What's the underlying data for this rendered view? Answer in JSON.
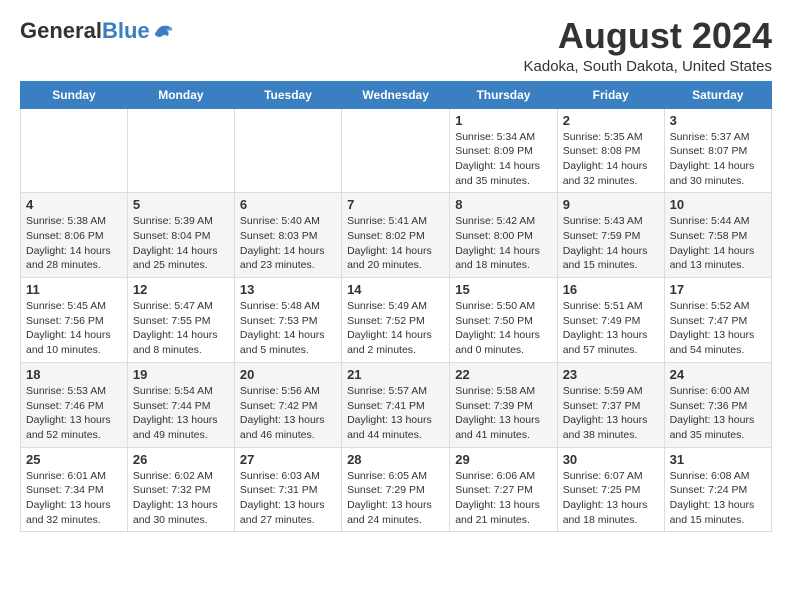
{
  "header": {
    "logo_general": "General",
    "logo_blue": "Blue",
    "month_title": "August 2024",
    "location": "Kadoka, South Dakota, United States"
  },
  "weekdays": [
    "Sunday",
    "Monday",
    "Tuesday",
    "Wednesday",
    "Thursday",
    "Friday",
    "Saturday"
  ],
  "weeks": [
    [
      {
        "day": "",
        "info": ""
      },
      {
        "day": "",
        "info": ""
      },
      {
        "day": "",
        "info": ""
      },
      {
        "day": "",
        "info": ""
      },
      {
        "day": "1",
        "info": "Sunrise: 5:34 AM\nSunset: 8:09 PM\nDaylight: 14 hours\nand 35 minutes."
      },
      {
        "day": "2",
        "info": "Sunrise: 5:35 AM\nSunset: 8:08 PM\nDaylight: 14 hours\nand 32 minutes."
      },
      {
        "day": "3",
        "info": "Sunrise: 5:37 AM\nSunset: 8:07 PM\nDaylight: 14 hours\nand 30 minutes."
      }
    ],
    [
      {
        "day": "4",
        "info": "Sunrise: 5:38 AM\nSunset: 8:06 PM\nDaylight: 14 hours\nand 28 minutes."
      },
      {
        "day": "5",
        "info": "Sunrise: 5:39 AM\nSunset: 8:04 PM\nDaylight: 14 hours\nand 25 minutes."
      },
      {
        "day": "6",
        "info": "Sunrise: 5:40 AM\nSunset: 8:03 PM\nDaylight: 14 hours\nand 23 minutes."
      },
      {
        "day": "7",
        "info": "Sunrise: 5:41 AM\nSunset: 8:02 PM\nDaylight: 14 hours\nand 20 minutes."
      },
      {
        "day": "8",
        "info": "Sunrise: 5:42 AM\nSunset: 8:00 PM\nDaylight: 14 hours\nand 18 minutes."
      },
      {
        "day": "9",
        "info": "Sunrise: 5:43 AM\nSunset: 7:59 PM\nDaylight: 14 hours\nand 15 minutes."
      },
      {
        "day": "10",
        "info": "Sunrise: 5:44 AM\nSunset: 7:58 PM\nDaylight: 14 hours\nand 13 minutes."
      }
    ],
    [
      {
        "day": "11",
        "info": "Sunrise: 5:45 AM\nSunset: 7:56 PM\nDaylight: 14 hours\nand 10 minutes."
      },
      {
        "day": "12",
        "info": "Sunrise: 5:47 AM\nSunset: 7:55 PM\nDaylight: 14 hours\nand 8 minutes."
      },
      {
        "day": "13",
        "info": "Sunrise: 5:48 AM\nSunset: 7:53 PM\nDaylight: 14 hours\nand 5 minutes."
      },
      {
        "day": "14",
        "info": "Sunrise: 5:49 AM\nSunset: 7:52 PM\nDaylight: 14 hours\nand 2 minutes."
      },
      {
        "day": "15",
        "info": "Sunrise: 5:50 AM\nSunset: 7:50 PM\nDaylight: 14 hours\nand 0 minutes."
      },
      {
        "day": "16",
        "info": "Sunrise: 5:51 AM\nSunset: 7:49 PM\nDaylight: 13 hours\nand 57 minutes."
      },
      {
        "day": "17",
        "info": "Sunrise: 5:52 AM\nSunset: 7:47 PM\nDaylight: 13 hours\nand 54 minutes."
      }
    ],
    [
      {
        "day": "18",
        "info": "Sunrise: 5:53 AM\nSunset: 7:46 PM\nDaylight: 13 hours\nand 52 minutes."
      },
      {
        "day": "19",
        "info": "Sunrise: 5:54 AM\nSunset: 7:44 PM\nDaylight: 13 hours\nand 49 minutes."
      },
      {
        "day": "20",
        "info": "Sunrise: 5:56 AM\nSunset: 7:42 PM\nDaylight: 13 hours\nand 46 minutes."
      },
      {
        "day": "21",
        "info": "Sunrise: 5:57 AM\nSunset: 7:41 PM\nDaylight: 13 hours\nand 44 minutes."
      },
      {
        "day": "22",
        "info": "Sunrise: 5:58 AM\nSunset: 7:39 PM\nDaylight: 13 hours\nand 41 minutes."
      },
      {
        "day": "23",
        "info": "Sunrise: 5:59 AM\nSunset: 7:37 PM\nDaylight: 13 hours\nand 38 minutes."
      },
      {
        "day": "24",
        "info": "Sunrise: 6:00 AM\nSunset: 7:36 PM\nDaylight: 13 hours\nand 35 minutes."
      }
    ],
    [
      {
        "day": "25",
        "info": "Sunrise: 6:01 AM\nSunset: 7:34 PM\nDaylight: 13 hours\nand 32 minutes."
      },
      {
        "day": "26",
        "info": "Sunrise: 6:02 AM\nSunset: 7:32 PM\nDaylight: 13 hours\nand 30 minutes."
      },
      {
        "day": "27",
        "info": "Sunrise: 6:03 AM\nSunset: 7:31 PM\nDaylight: 13 hours\nand 27 minutes."
      },
      {
        "day": "28",
        "info": "Sunrise: 6:05 AM\nSunset: 7:29 PM\nDaylight: 13 hours\nand 24 minutes."
      },
      {
        "day": "29",
        "info": "Sunrise: 6:06 AM\nSunset: 7:27 PM\nDaylight: 13 hours\nand 21 minutes."
      },
      {
        "day": "30",
        "info": "Sunrise: 6:07 AM\nSunset: 7:25 PM\nDaylight: 13 hours\nand 18 minutes."
      },
      {
        "day": "31",
        "info": "Sunrise: 6:08 AM\nSunset: 7:24 PM\nDaylight: 13 hours\nand 15 minutes."
      }
    ]
  ]
}
